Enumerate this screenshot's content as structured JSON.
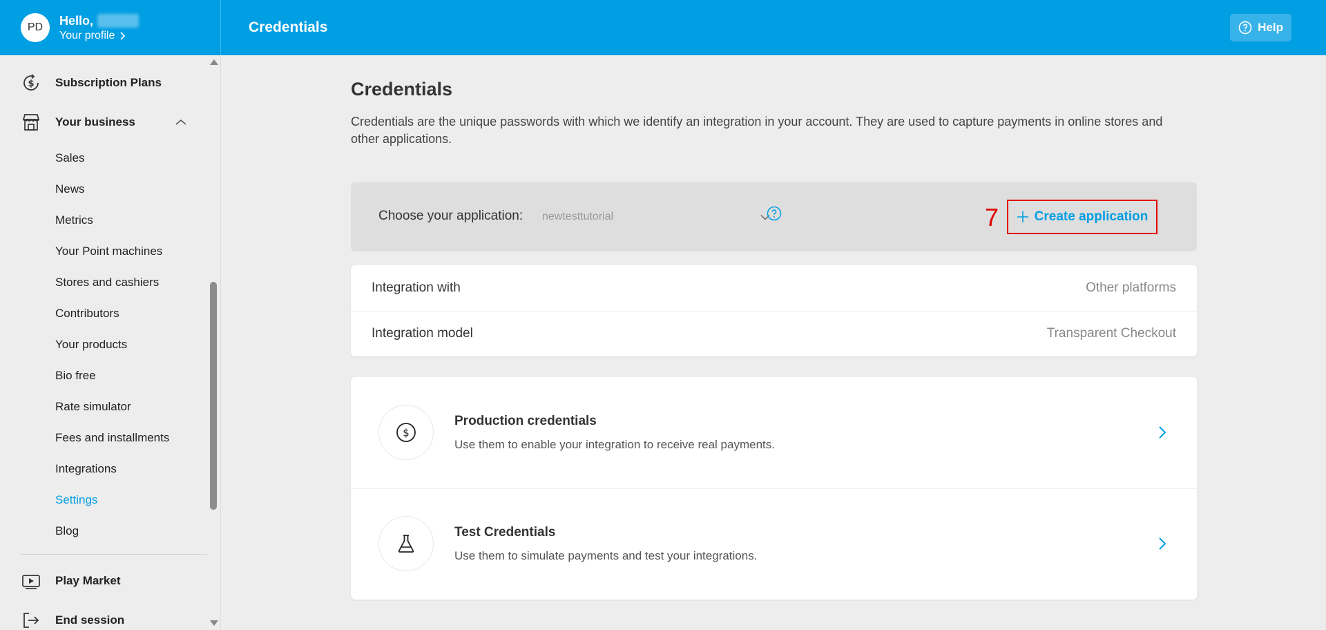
{
  "header": {
    "avatar_initials": "PD",
    "hello": "Hello,",
    "profile_link": "Your profile",
    "title": "Credentials",
    "help_label": "Help",
    "brand_color": "#009ee3"
  },
  "sidebar": {
    "top_items": [
      {
        "label": "Subscription Plans",
        "icon": "dollar-cycle-icon"
      },
      {
        "label": "Your business",
        "icon": "store-icon"
      }
    ],
    "sub_items": [
      {
        "label": "Sales"
      },
      {
        "label": "News"
      },
      {
        "label": "Metrics"
      },
      {
        "label": "Your Point machines"
      },
      {
        "label": "Stores and cashiers"
      },
      {
        "label": "Contributors"
      },
      {
        "label": "Your products"
      },
      {
        "label": "Bio free"
      },
      {
        "label": "Rate simulator"
      },
      {
        "label": "Fees and installments"
      },
      {
        "label": "Integrations"
      },
      {
        "label": "Settings",
        "active": true
      },
      {
        "label": "Blog"
      }
    ],
    "bottom_items": [
      {
        "label": "Play Market",
        "icon": "play-icon"
      },
      {
        "label": "End session",
        "icon": "logout-icon"
      }
    ]
  },
  "main": {
    "title": "Credentials",
    "description": "Credentials are the unique passwords with which we identify an integration in your account. They are used to capture payments in online stores and other applications.",
    "app_chooser": {
      "label": "Choose your application:",
      "selected": "newtesttutorial",
      "create_label": "Create application",
      "step_number": "7"
    },
    "integration": [
      {
        "key": "Integration with",
        "value": "Other platforms"
      },
      {
        "key": "Integration model",
        "value": "Transparent Checkout"
      }
    ],
    "credentials": [
      {
        "title": "Production credentials",
        "subtitle": "Use them to enable your integration to receive real payments.",
        "icon": "dollar-icon"
      },
      {
        "title": "Test Credentials",
        "subtitle": "Use them to simulate payments and test your integrations.",
        "icon": "flask-icon"
      }
    ]
  }
}
